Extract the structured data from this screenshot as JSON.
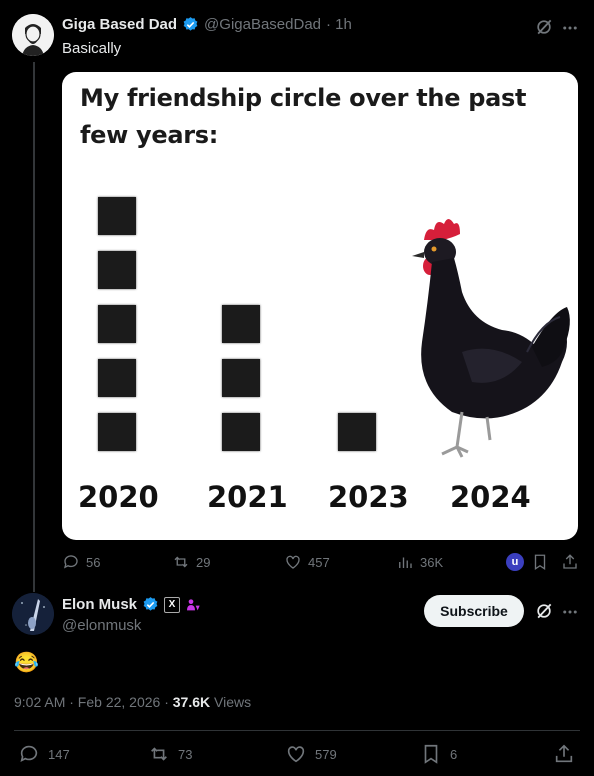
{
  "original_post": {
    "author_name": "Giga Based Dad",
    "handle": "@GigaBasedDad",
    "time": "· 1h",
    "text": "Basically",
    "meme": {
      "title": "My friendship circle over the past few years:",
      "years": [
        "2020",
        "2021",
        "2023",
        "2024"
      ]
    },
    "actions": {
      "replies": "56",
      "reposts": "29",
      "likes": "457",
      "views": "36K"
    },
    "mini_avatar_letter": "u"
  },
  "reply": {
    "author_name": "Elon Musk",
    "handle": "@elonmusk",
    "text": "😂",
    "subscribe_label": "Subscribe",
    "timestamp": "9:02 AM · Feb 22, 2026 · ",
    "views_count": "37.6K",
    "views_label": " Views",
    "actions": {
      "replies": "147",
      "reposts": "73",
      "likes": "579",
      "bookmarks": "6"
    }
  },
  "colors": {
    "verified": "#1d9bf0",
    "background": "#000000",
    "muted": "#71767b"
  }
}
